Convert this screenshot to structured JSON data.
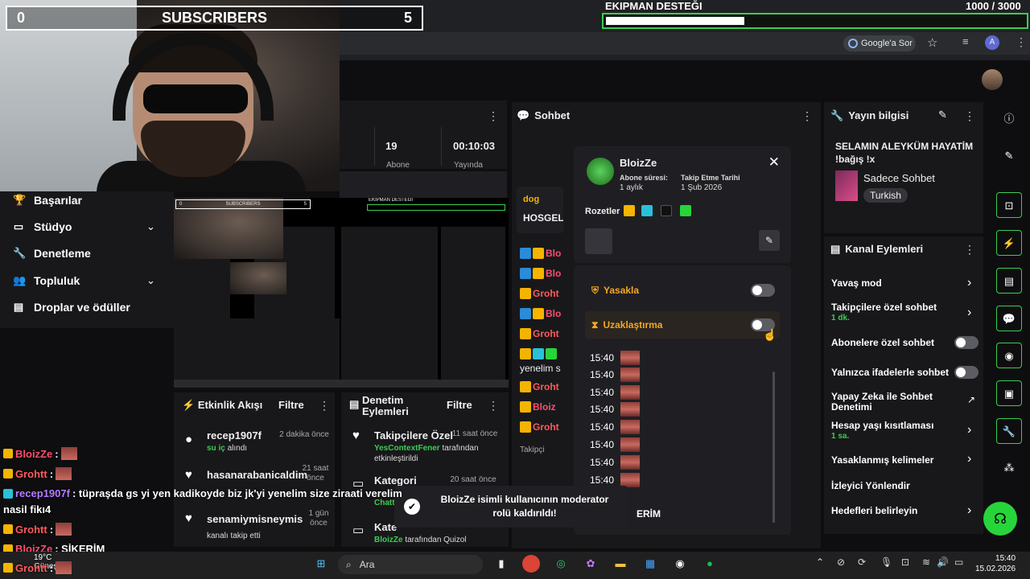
{
  "overlay": {
    "subscriber_left": "0",
    "subscriber_label": "SUBSCRIBERS",
    "subscriber_right": "5",
    "equipment_title": "EKIPMAN DESTEĞI",
    "equipment_current": "1000",
    "equipment_sep": "/",
    "equipment_goal": "3000",
    "equipment_progress": 0.33
  },
  "browser": {
    "google_ask": "Google'a Sor",
    "account_initial": "A"
  },
  "nav": {
    "items": [
      {
        "label": "Başarılar",
        "icon": "trophy-icon"
      },
      {
        "label": "Stüdyo",
        "icon": "studio-icon"
      },
      {
        "label": "Denetleme",
        "icon": "wrench-icon"
      },
      {
        "label": "Topluluk",
        "icon": "people-icon"
      },
      {
        "label": "Droplar ve ödüller",
        "icon": "gift-icon"
      }
    ]
  },
  "stats": {
    "value1": "19",
    "value2": "00:10:03",
    "label1": "Abone",
    "label2": "Yayında"
  },
  "chat": {
    "title": "Sohbet",
    "pin_user": "dog",
    "pin_text": "HOSGELI",
    "snippet_1": "yenelim s",
    "snippet_2": "Takipçi",
    "snippet_3": "ERİM",
    "lines": [
      "Blo",
      "Blo",
      "Groht",
      "Blo",
      "Groht",
      "Blo",
      "Groht",
      "Bloiz",
      "Groht"
    ]
  },
  "viewer_card": {
    "name": "BloizZe",
    "sub_label": "Abone süresi:",
    "sub_value": "1 aylık",
    "follow_label": "Takip Etme Tarihi",
    "follow_value": "1 Şub 2026",
    "badges_label": "Rozetler",
    "mod_ban": "Yasakla",
    "mod_timeout": "Uzaklaştırma",
    "times": [
      "15:40",
      "15:40",
      "15:40",
      "15:40",
      "15:40",
      "15:40",
      "15:40",
      "15:40"
    ]
  },
  "stream_info": {
    "header": "Yayın bilgisi",
    "title": "SELAMIN ALEYKÜM HAYATİM !bağış !x",
    "category": "Sadece Sohbet",
    "tag": "Turkish"
  },
  "channel_actions": {
    "header": "Kanal Eylemleri",
    "items": [
      {
        "label": "Yavaş mod",
        "sub": ""
      },
      {
        "label": "Takipçilere özel sohbet",
        "sub": "1 dk."
      },
      {
        "label": "Abonelere özel sohbet",
        "sub": ""
      },
      {
        "label": "Yalnızca ifadelerle sohbet",
        "sub": ""
      },
      {
        "label": "Yapay Zeka ile Sohbet Denetimi",
        "sub": ""
      },
      {
        "label": "Hesap yaşı kısıtlaması",
        "sub": "1 sa."
      },
      {
        "label": "Yasaklanmış kelimeler",
        "sub": ""
      },
      {
        "label": "İzleyici Yönlendir",
        "sub": ""
      },
      {
        "label": "Hedefleri belirleyin",
        "sub": ""
      }
    ]
  },
  "activity": {
    "title": "Etkinlik Akışı",
    "filter": "Filtre",
    "events": [
      {
        "name": "recep1907f",
        "sub_highlight": "su iç",
        "sub_rest": " alındı",
        "time": "2 dakika önce"
      },
      {
        "name": "hasanarabanicaldim",
        "sub_highlight": "",
        "sub_rest": "",
        "time": "21 saat önce"
      },
      {
        "name": "senamiymisneymis",
        "sub_highlight": "",
        "sub_rest": "kanalı takip etti",
        "time": "1 gün önce"
      }
    ]
  },
  "moderation": {
    "title": "Denetim Eylemleri",
    "filter": "Filtre",
    "events": [
      {
        "name": "Takipçilere Özel",
        "actor": "YesContextFener",
        "rest": " tarafından etkinleştirildi",
        "time": "11 saat önce"
      },
      {
        "name": "Kategori",
        "actor": "Chatt",
        "rest": "",
        "time": "20 saat önce"
      },
      {
        "name": "Kate",
        "actor": "BloizZe",
        "rest": " tarafından Quizol",
        "time": ""
      }
    ]
  },
  "toast": {
    "message": "BloizZe isimli kullanıcının moderator rolü kaldırıldı!"
  },
  "overlay_chat": [
    {
      "user": "BloizZe",
      "color": "#ff4d6d",
      "msg": ":"
    },
    {
      "user": "Grohtt",
      "color": "#ff5a5a",
      "msg": ":"
    },
    {
      "user": "recep1907f",
      "color": "#b77bff",
      "msg": ": tüpraşda gs yi yen kadikoyde biz jk'yi yenelim size ziraati verelim"
    },
    {
      "user": "",
      "color": "#fff",
      "msg": "nasil fikı4"
    },
    {
      "user": "Grohtt",
      "color": "#ff5a5a",
      "msg": ":"
    },
    {
      "user": "BloizZe",
      "color": "#ff4d6d",
      "msg": ": SİKERİM"
    },
    {
      "user": "Grohtt",
      "color": "#ff5a5a",
      "msg": ":"
    }
  ],
  "taskbar": {
    "weather_temp": "19°C",
    "weather_desc": "Güneşli",
    "search": "Ara",
    "time": "15:40",
    "date": "15.02.2026"
  },
  "nested_preview": {
    "sub_left": "0",
    "sub_label": "SUBSCRIBERS",
    "sub_right": "5",
    "eq": "EKIPMAN DESTEĞI"
  }
}
